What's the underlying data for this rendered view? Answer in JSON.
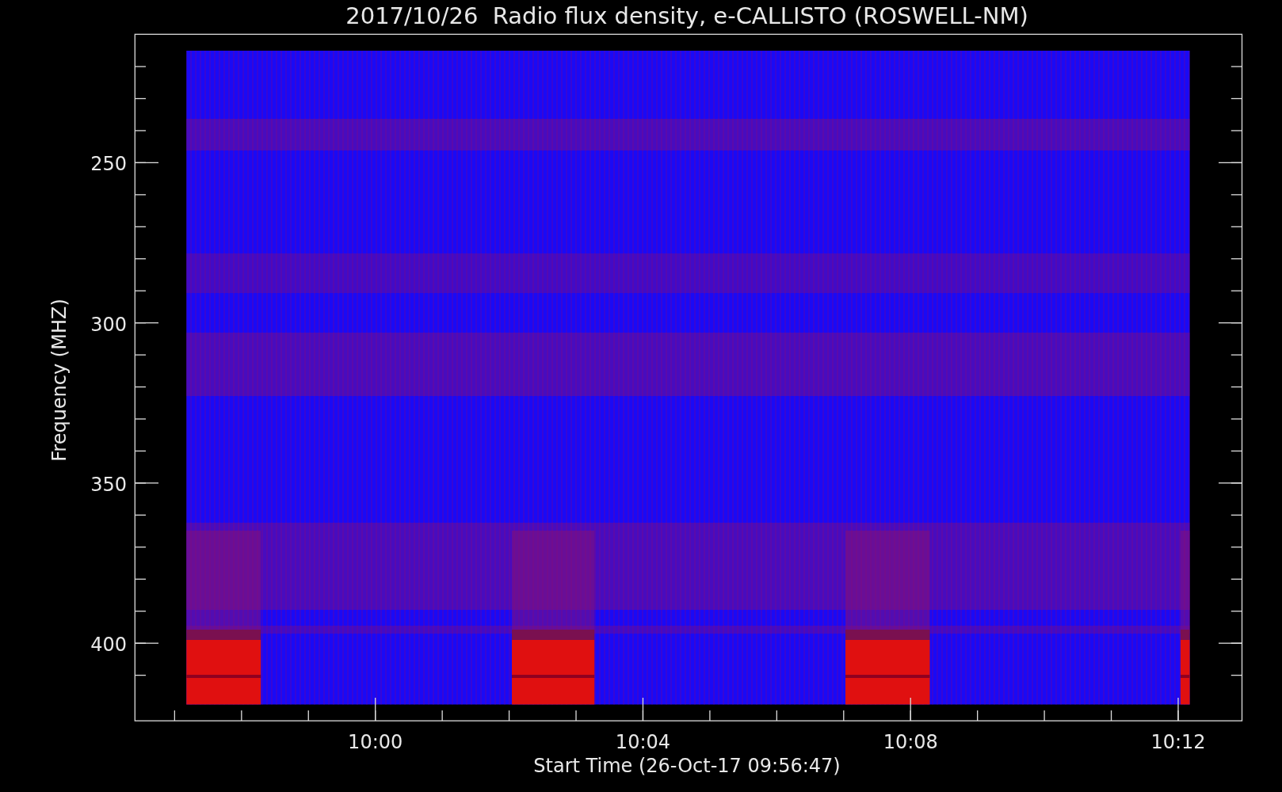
{
  "title": "2017/10/26  Radio flux density, e-CALLISTO (ROSWELL-NM)",
  "y_axis": {
    "label": "Frequency (MHZ)",
    "ticks": [
      "250",
      "300",
      "350",
      "400"
    ]
  },
  "x_axis": {
    "label": "Start Time (26-Oct-17 09:56:47)",
    "ticks": [
      "10:00",
      "10:04",
      "10:08",
      "10:12"
    ]
  }
}
